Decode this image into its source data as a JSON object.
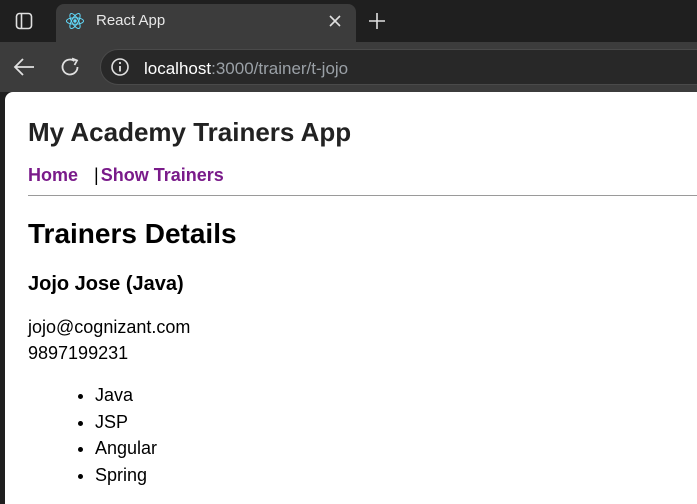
{
  "browser": {
    "tab": {
      "title": "React App",
      "favicon": "react-logo-icon"
    },
    "url": {
      "host": "localhost",
      "path": ":3000/trainer/t-jojo"
    }
  },
  "page": {
    "app_title": "My Academy Trainers App",
    "nav": {
      "home": "Home",
      "separator": "|",
      "show_trainers": "Show Trainers"
    },
    "heading": "Trainers Details",
    "trainer": {
      "name": "Jojo Jose (Java)",
      "email": "jojo@cognizant.com",
      "phone": "9897199231",
      "skills": [
        "Java",
        "JSP",
        "Angular",
        "Spring"
      ]
    }
  },
  "colors": {
    "link": "#7a1b8a",
    "tab_bg": "#3c3c3c",
    "chrome_bg": "#1f1f1f"
  }
}
